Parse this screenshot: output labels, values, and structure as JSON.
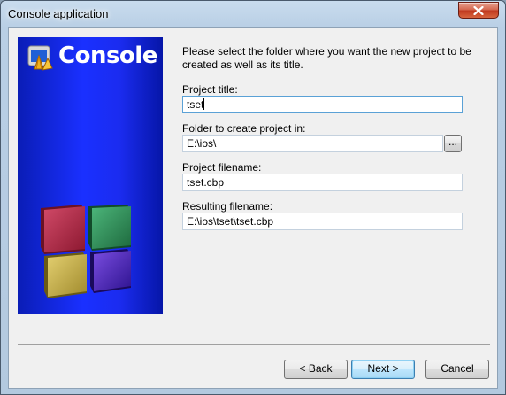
{
  "window": {
    "title": "Console application"
  },
  "banner": {
    "title": "Console"
  },
  "intro": {
    "text": "Please select the folder where you want the new project to be created as well as its title."
  },
  "fields": {
    "project_title": {
      "label": "Project title:",
      "value": "tset"
    },
    "folder": {
      "label": "Folder to create project in:",
      "value": "E:\\ios\\",
      "browse_label": "..."
    },
    "project_filename": {
      "label": "Project filename:",
      "value": "tset.cbp"
    },
    "resulting_filename": {
      "label": "Resulting filename:",
      "value": "E:\\ios\\tset\\tset.cbp"
    }
  },
  "buttons": {
    "back": "< Back",
    "next": "Next >",
    "cancel": "Cancel"
  },
  "colors": {
    "banner_blue": "#1a30ff",
    "close_red": "#c0391f",
    "cube_red": "#b0243a",
    "cube_green": "#2e8a56",
    "cube_yellow": "#c9b24a",
    "cube_purple": "#4c22b8"
  },
  "icons": {
    "close": "close-icon",
    "app_logo": "codeblocks-shell-icon",
    "cubes": "codeblocks-cubes-logo"
  }
}
